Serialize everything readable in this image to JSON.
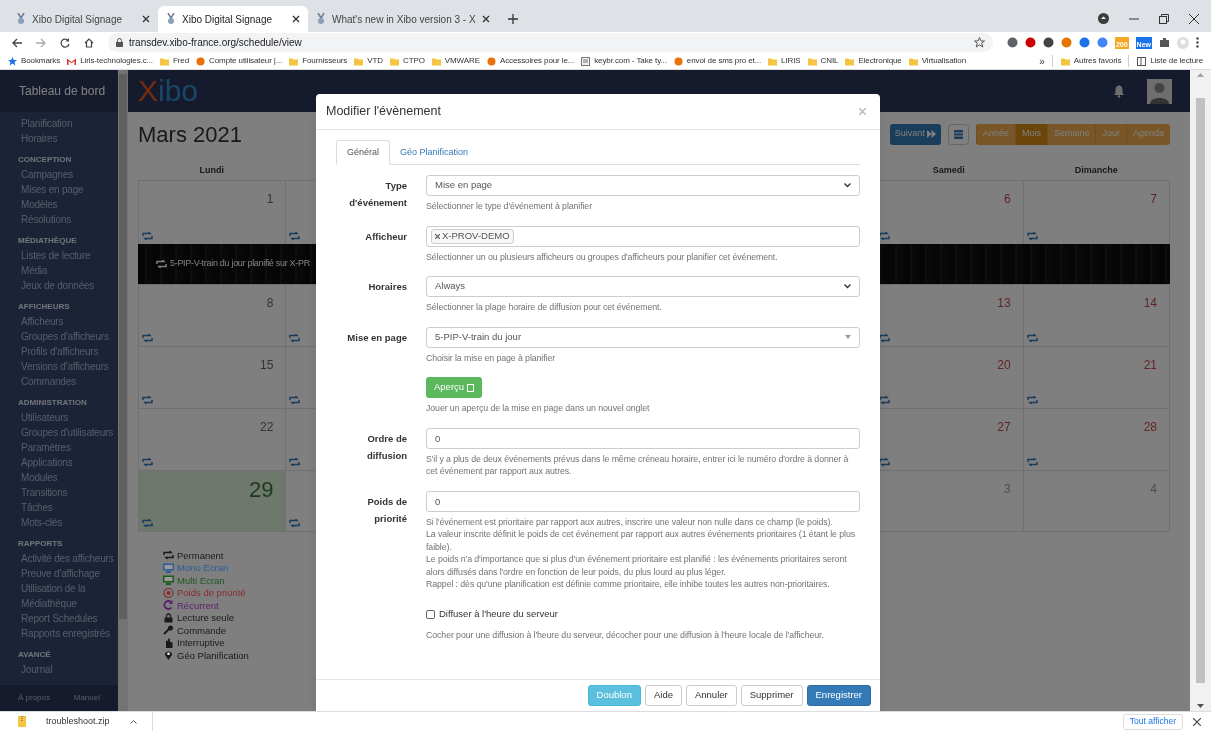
{
  "browser": {
    "tabs": [
      {
        "title": "Xibo Digital Signage",
        "selected": false
      },
      {
        "title": "Xibo Digital Signage",
        "selected": true
      },
      {
        "title": "What's new in Xibo version 3 - X",
        "selected": false
      }
    ],
    "address": "transdev.xibo-france.org/schedule/view",
    "extension_badges": [
      "200",
      "New"
    ],
    "bookmarks": [
      {
        "label": "Bookmarks",
        "kind": "star"
      },
      {
        "label": "Liris-technologies.c...",
        "kind": "mail"
      },
      {
        "label": "Fred",
        "kind": "folder"
      },
      {
        "label": "Compte utilisateur |...",
        "kind": "site"
      },
      {
        "label": "Fournisseurs",
        "kind": "folder"
      },
      {
        "label": "VTD",
        "kind": "folder"
      },
      {
        "label": "CTPO",
        "kind": "folder"
      },
      {
        "label": "VMWARE",
        "kind": "folder"
      },
      {
        "label": "Accessoires pour le...",
        "kind": "site"
      },
      {
        "label": "keybr.com - Take ty...",
        "kind": "page"
      },
      {
        "label": "envoi de sms pro et...",
        "kind": "site"
      },
      {
        "label": "LIRIS",
        "kind": "folder"
      },
      {
        "label": "CNIL",
        "kind": "folder"
      },
      {
        "label": "Electronique",
        "kind": "folder"
      },
      {
        "label": "Virtualisation",
        "kind": "folder"
      }
    ],
    "more": "»",
    "other_bookmarks": "Autres favoris",
    "reading_list": "Liste de lecture"
  },
  "sidebar": {
    "title": "Tableau de bord",
    "sections": [
      {
        "items": [
          "Planification",
          "Horaires"
        ]
      },
      {
        "heading": "CONCEPTION",
        "items": [
          "Campagnes",
          "Mises en page",
          "Modèles",
          "Résolutions"
        ]
      },
      {
        "heading": "MÉDIATHÈQUE",
        "items": [
          "Listes de lecture",
          "Média",
          "Jeux de données"
        ]
      },
      {
        "heading": "AFFICHEURS",
        "items": [
          "Afficheurs",
          "Groupes d'afficheurs",
          "Profils d'afficheurs",
          "Versions d'afficheurs",
          "Commandes"
        ]
      },
      {
        "heading": "ADMINISTRATION",
        "items": [
          "Utilisateurs",
          "Groupes d'utilisateurs",
          "Paramètres",
          "Applications",
          "Modules",
          "Transitions",
          "Tâches",
          "Mots-clés"
        ]
      },
      {
        "heading": "RAPPORTS",
        "items": [
          "Activité des afficheurs",
          "Preuve d'affichage",
          "Utilisation de la Médiathèque",
          "Report Schedules",
          "Rapports enregistrés"
        ]
      },
      {
        "heading": "AVANCÉ",
        "items": [
          "Journal"
        ]
      }
    ],
    "footer": [
      "À propos",
      "Manuel"
    ]
  },
  "main": {
    "logo": "Xibo",
    "month": "Mars 2021",
    "next": "Suivant",
    "views": [
      {
        "label": "Année",
        "selected": false
      },
      {
        "label": "Mois",
        "selected": true
      },
      {
        "label": "Semaine",
        "selected": false
      },
      {
        "label": "Jour",
        "selected": false
      },
      {
        "label": "Agenda",
        "selected": false
      }
    ],
    "calendar": {
      "headers": [
        "Lundi",
        "Samedi",
        "Dimanche"
      ],
      "weeks": [
        {
          "days": [
            {
              "number": "1",
              "today": false,
              "other_month": false
            },
            {
              "number": "6",
              "today": false,
              "other_month": false
            },
            {
              "number": "7",
              "today": false,
              "other_month": false
            }
          ],
          "event": "5-PIP-V-train du jour planifié sur X-PR"
        },
        {
          "days": [
            {
              "number": "8",
              "today": false,
              "other_month": false
            },
            {
              "number": "13",
              "today": false,
              "other_month": false
            },
            {
              "number": "14",
              "today": false,
              "other_month": false
            }
          ]
        },
        {
          "days": [
            {
              "number": "15",
              "today": false,
              "other_month": false
            },
            {
              "number": "20",
              "today": false,
              "other_month": false
            },
            {
              "number": "21",
              "today": false,
              "other_month": false
            }
          ]
        },
        {
          "days": [
            {
              "number": "22",
              "today": false,
              "other_month": false
            },
            {
              "number": "27",
              "today": false,
              "other_month": false
            },
            {
              "number": "28",
              "today": false,
              "other_month": false
            }
          ]
        },
        {
          "days": [
            {
              "number": "29",
              "today": true,
              "other_month": false
            },
            {
              "number": "3",
              "today": false,
              "other_month": true
            },
            {
              "number": "4",
              "today": false,
              "other_month": true
            }
          ]
        }
      ]
    },
    "legend": [
      {
        "label": "Permanent",
        "kind": "repeat",
        "color": "#1a1a1a"
      },
      {
        "label": "Mono Ecran",
        "kind": "monitor",
        "color": "#2b5d9c"
      },
      {
        "label": "Multi Ecran",
        "kind": "monitor",
        "color": "#1e5a1e"
      },
      {
        "label": "Poids de priorité",
        "kind": "target",
        "color": "#8a2c2c"
      },
      {
        "label": "Récurrent",
        "kind": "refresh",
        "color": "#5a1f6b"
      },
      {
        "label": "Lecture seule",
        "kind": "lock",
        "color": "#1a1a1a"
      },
      {
        "label": "Commande",
        "kind": "wrench",
        "color": "#1a1a1a"
      },
      {
        "label": "Interruptive",
        "kind": "hand",
        "color": "#1a1a1a"
      },
      {
        "label": "Géo Planification",
        "kind": "pin",
        "color": "#1a1a1a"
      }
    ]
  },
  "modal": {
    "title": "Modifier l'évènement",
    "tabs": [
      {
        "label": "Général",
        "selected": true
      },
      {
        "label": "Géo Planification",
        "selected": false
      }
    ],
    "fields": [
      {
        "kind": "select",
        "label": "Type d'événement",
        "value": "Mise en page",
        "help": [
          "Sélectionner le type d'événement à planifier"
        ]
      },
      {
        "kind": "tags",
        "label": "Afficheur",
        "tags": [
          "X-PROV-DEMO"
        ],
        "help": [
          "Sélectionner un ou plusieurs afficheurs ou groupes d'afficheurs pour planifier cet événement."
        ]
      },
      {
        "kind": "select",
        "label": "Horaires",
        "value": "Always",
        "help": [
          "Sélectionner la plage horaire de diffusion pour cet événement."
        ]
      },
      {
        "kind": "select2",
        "label": "Mise en page",
        "value": "5-PIP-V-train du jour",
        "help": [
          "Choisir la mise en page à planifier"
        ]
      },
      {
        "kind": "button",
        "button": "Aperçu",
        "help": [
          "Jouer un aperçu de la mise en page dans un nouvel onglet"
        ]
      },
      {
        "kind": "number",
        "label": "Ordre de diffusion",
        "value": "0",
        "help": [
          "S'il y a plus de deux événements prévus dans le même créneau horaire, entrer ici le numéro d'ordre à donner à cet événement par rapport aux autres."
        ]
      },
      {
        "kind": "number",
        "label": "Poids de priorité",
        "value": "0",
        "help": [
          "Si l'événement est prioritaire par rapport aux autres, inscrire une valeur non nulle dans ce champ (le poids).",
          "La valeur inscrite définit le poids de cet événement par rapport aux autres événements prioritaires (1 étant le plus faible).",
          "Le poids n'a d'importance que si plus d'un événement prioritaire est planifié : les événements prioritaires seront alors diffusés dans l'ordre en fonction de leur poids, du plus lourd au plus léger.",
          "Rappel : dès qu'une planification est définie comme prioritaire, elle inhibe toutes les autres non-prioritaires."
        ]
      },
      {
        "kind": "checkbox",
        "label": "Diffuser à l'heure du serveur",
        "checked": false,
        "help": [
          "Cocher pour une diffusion à l'heure du serveur, décocher pour une diffusion à l'heure locale de l'afficheur."
        ]
      }
    ],
    "buttons": [
      {
        "label": "Doublon",
        "kind": "info"
      },
      {
        "label": "Aide",
        "kind": "default"
      },
      {
        "label": "Annuler",
        "kind": "default"
      },
      {
        "label": "Supprimer",
        "kind": "default"
      },
      {
        "label": "Enregistrer",
        "kind": "primary"
      }
    ]
  },
  "downloads": {
    "file": "troubleshoot.zip",
    "show_all": "Tout afficher"
  }
}
